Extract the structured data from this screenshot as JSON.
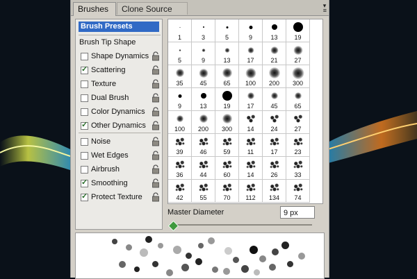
{
  "tabs": [
    {
      "label": "Brushes",
      "close": "×"
    },
    {
      "label": "Clone Source"
    }
  ],
  "presets_label": "Brush Presets",
  "tip_shape_label": "Brush Tip Shape",
  "options": [
    {
      "label": "Shape Dynamics",
      "checked": false
    },
    {
      "label": "Scattering",
      "checked": true
    },
    {
      "label": "Texture",
      "checked": false
    },
    {
      "label": "Dual Brush",
      "checked": false
    },
    {
      "label": "Color Dynamics",
      "checked": false
    },
    {
      "label": "Other Dynamics",
      "checked": true
    },
    {
      "label": "Noise",
      "checked": false
    },
    {
      "label": "Wet Edges",
      "checked": false
    },
    {
      "label": "Airbrush",
      "checked": false
    },
    {
      "label": "Smoothing",
      "checked": true
    },
    {
      "label": "Protect Texture",
      "checked": true
    }
  ],
  "brushes": [
    [
      {
        "n": "1"
      },
      {
        "n": "3"
      },
      {
        "n": "5"
      },
      {
        "n": "9"
      },
      {
        "n": "13"
      },
      {
        "n": "19"
      }
    ],
    [
      {
        "n": "5"
      },
      {
        "n": "9"
      },
      {
        "n": "13"
      },
      {
        "n": "17"
      },
      {
        "n": "21"
      },
      {
        "n": "27"
      }
    ],
    [
      {
        "n": "35"
      },
      {
        "n": "45"
      },
      {
        "n": "65"
      },
      {
        "n": "100"
      },
      {
        "n": "200"
      },
      {
        "n": "300"
      }
    ],
    [
      {
        "n": "9"
      },
      {
        "n": "13"
      },
      {
        "n": "19"
      },
      {
        "n": "17"
      },
      {
        "n": "45"
      },
      {
        "n": "65"
      }
    ],
    [
      {
        "n": "100"
      },
      {
        "n": "200"
      },
      {
        "n": "300"
      },
      {
        "n": "14"
      },
      {
        "n": "24"
      },
      {
        "n": "27"
      }
    ],
    [
      {
        "n": "39"
      },
      {
        "n": "46"
      },
      {
        "n": "59"
      },
      {
        "n": "11"
      },
      {
        "n": "17"
      },
      {
        "n": "23"
      }
    ],
    [
      {
        "n": "36"
      },
      {
        "n": "44"
      },
      {
        "n": "60"
      },
      {
        "n": "14"
      },
      {
        "n": "26"
      },
      {
        "n": "33"
      }
    ],
    [
      {
        "n": "42"
      },
      {
        "n": "55"
      },
      {
        "n": "70"
      },
      {
        "n": "112"
      },
      {
        "n": "134"
      },
      {
        "n": "74"
      }
    ]
  ],
  "master_diameter": {
    "label": "Master Diameter",
    "value": "9 px"
  }
}
